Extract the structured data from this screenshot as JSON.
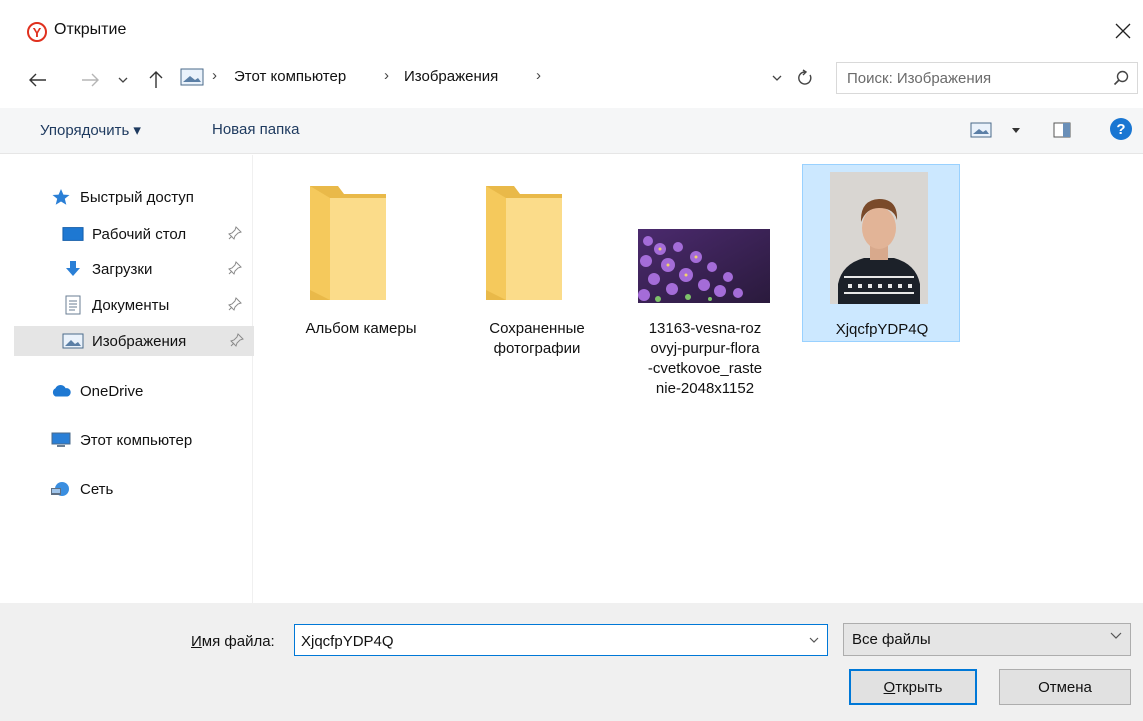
{
  "window": {
    "title": "Открытие"
  },
  "address": {
    "crumbs": [
      "Этот компьютер",
      "Изображения"
    ]
  },
  "search": {
    "placeholder": "Поиск: Изображения"
  },
  "toolbar": {
    "organize_label": "Упорядочить ▾",
    "new_folder_label": "Новая папка",
    "help_glyph": "?"
  },
  "sidebar": {
    "items": [
      {
        "label": "Быстрый доступ",
        "icon": "star-icon"
      },
      {
        "label": "Рабочий стол",
        "icon": "desktop-icon",
        "pinned": true
      },
      {
        "label": "Загрузки",
        "icon": "download-icon",
        "pinned": true
      },
      {
        "label": "Документы",
        "icon": "document-icon",
        "pinned": true
      },
      {
        "label": "Изображения",
        "icon": "pictures-icon",
        "pinned": true,
        "selected": true
      },
      {
        "label": "OneDrive",
        "icon": "cloud-icon"
      },
      {
        "label": "Этот компьютер",
        "icon": "computer-icon"
      },
      {
        "label": "Сеть",
        "icon": "network-icon"
      }
    ]
  },
  "files": [
    {
      "name_lines": [
        "Альбом камеры"
      ],
      "kind": "folder"
    },
    {
      "name_lines": [
        "Сохраненные",
        "фотографии"
      ],
      "kind": "folder"
    },
    {
      "name_lines": [
        "13163-vesna-roz",
        "ovyj-purpur-flora",
        "-cvetkovoe_raste",
        "nie-2048x1152"
      ],
      "kind": "image-flowers"
    },
    {
      "name_lines": [
        "XjqcfpYDP4Q"
      ],
      "kind": "image-portrait",
      "selected": true
    }
  ],
  "footer": {
    "filename_label_prefix": "И",
    "filename_label_rest": "мя файла:",
    "filename_value": "XjqcfpYDP4Q",
    "filetype_value": "Все файлы",
    "open_label_prefix": "О",
    "open_label_rest": "ткрыть",
    "cancel_label": "Отмена"
  },
  "colors": {
    "accent": "#0078d7",
    "selection": "#cce8ff",
    "folder": "#f8d775",
    "help": "#1976d2"
  }
}
